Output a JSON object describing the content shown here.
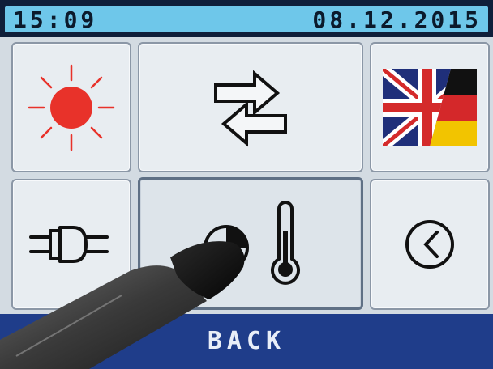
{
  "status_bar": {
    "time": "15:09",
    "date": "08.12.2015"
  },
  "tiles": [
    {
      "id": "brightness",
      "icon": "sun-icon"
    },
    {
      "id": "swap",
      "icon": "swap-arrows-icon"
    },
    {
      "id": "language",
      "icon": "uk-germany-flag-icon"
    },
    {
      "id": "power",
      "icon": "power-plug-icon"
    },
    {
      "id": "temperature",
      "icon": "pie-thermometer-icon"
    },
    {
      "id": "clock",
      "icon": "clock-icon"
    }
  ],
  "back": {
    "label": "BACK"
  },
  "colors": {
    "accent": "#6ec7ea",
    "bottom_bar": "#1f3d8a",
    "sun": "#e8322a"
  }
}
